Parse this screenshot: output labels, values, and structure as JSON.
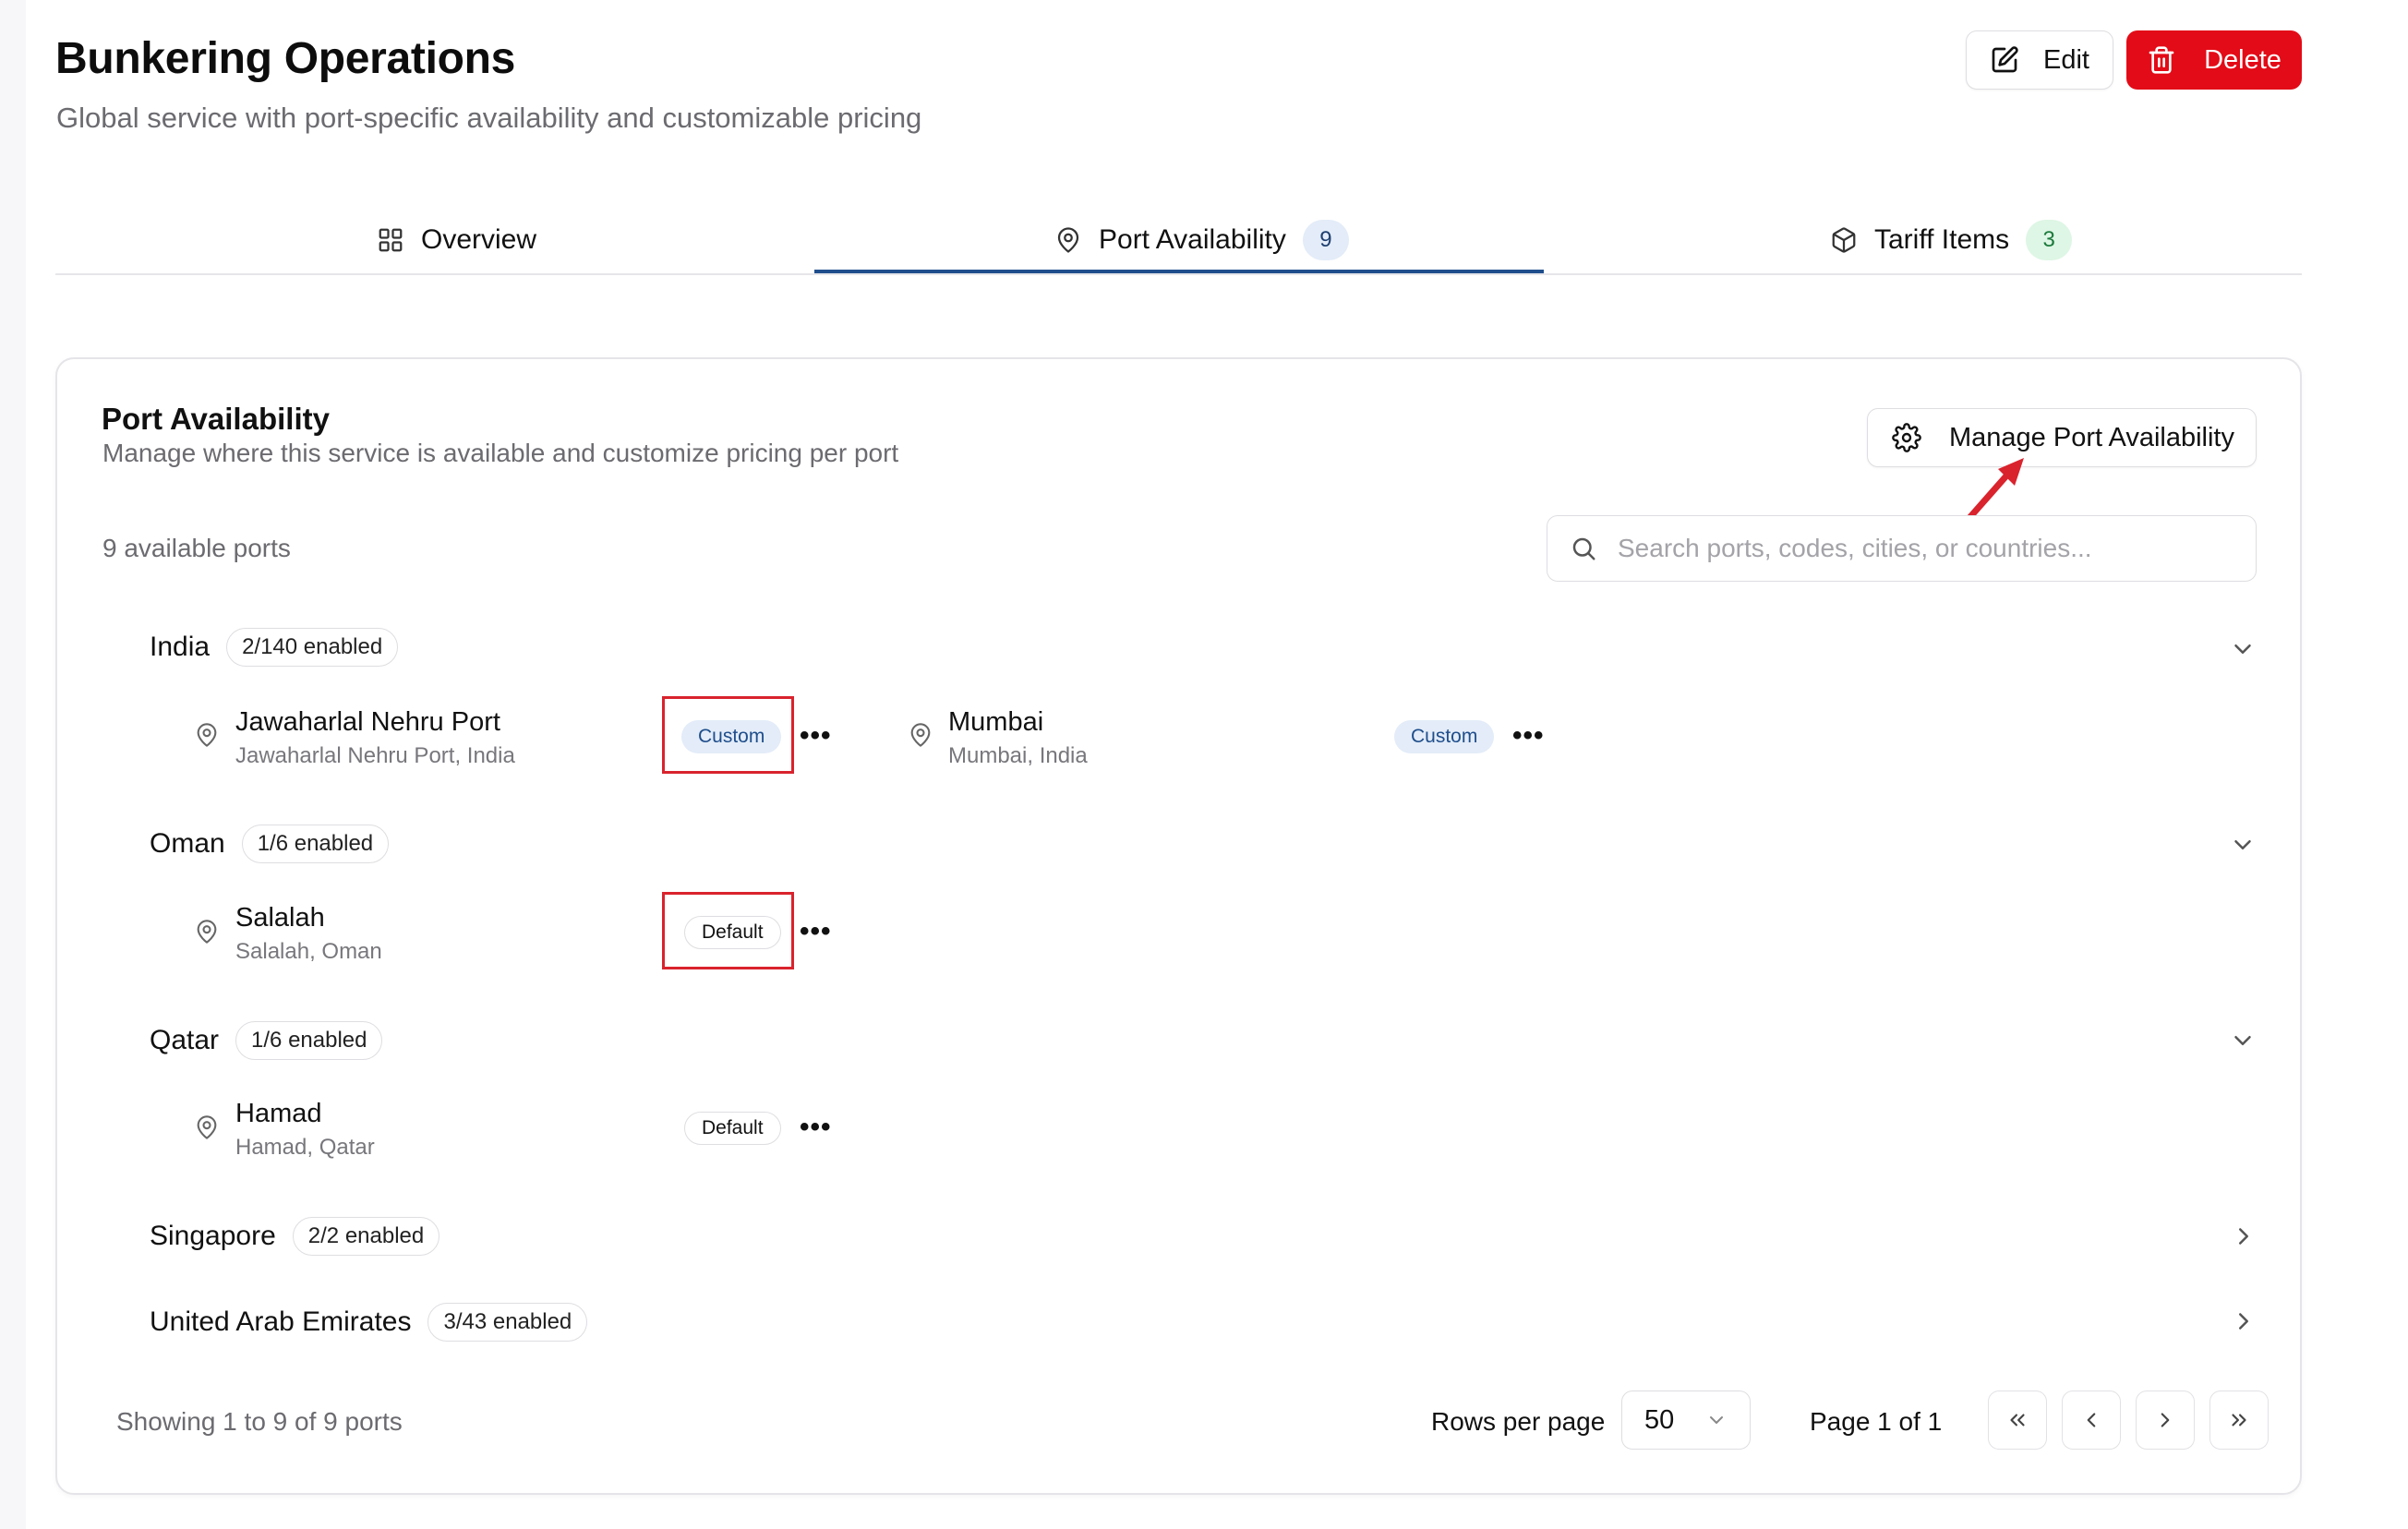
{
  "header": {
    "title": "Bunkering Operations",
    "subtitle": "Global service with port-specific availability and customizable pricing",
    "edit_label": "Edit",
    "delete_label": "Delete"
  },
  "tabs": [
    {
      "label": "Overview",
      "icon": "grid-icon"
    },
    {
      "label": "Port Availability",
      "icon": "map-pin-icon",
      "count": "9",
      "active": true
    },
    {
      "label": "Tariff Items",
      "icon": "package-icon",
      "count": "3"
    }
  ],
  "card": {
    "title": "Port Availability",
    "subtitle": "Manage where this service is available and customize pricing per port",
    "manage_label": "Manage Port Availability",
    "available_count": "9 available ports",
    "search_placeholder": "Search ports, codes, cities, or countries..."
  },
  "groups": [
    {
      "country": "India",
      "enabled": "2/140 enabled",
      "expanded": true,
      "ports": [
        {
          "name": "Jawaharlal Nehru Port",
          "location": "Jawaharlal Nehru Port, India",
          "tag": "Custom"
        },
        {
          "name": "Mumbai",
          "location": "Mumbai, India",
          "tag": "Custom"
        }
      ]
    },
    {
      "country": "Oman",
      "enabled": "1/6 enabled",
      "expanded": true,
      "ports": [
        {
          "name": "Salalah",
          "location": "Salalah, Oman",
          "tag": "Default"
        }
      ]
    },
    {
      "country": "Qatar",
      "enabled": "1/6 enabled",
      "expanded": true,
      "ports": [
        {
          "name": "Hamad",
          "location": "Hamad, Qatar",
          "tag": "Default"
        }
      ]
    },
    {
      "country": "Singapore",
      "enabled": "2/2 enabled",
      "expanded": false,
      "ports": []
    },
    {
      "country": "United Arab Emirates",
      "enabled": "3/43 enabled",
      "expanded": false,
      "ports": []
    }
  ],
  "more_glyph": "•••",
  "footer": {
    "showing": "Showing 1 to 9 of 9 ports",
    "rows_label": "Rows per page",
    "rows_value": "50",
    "page_label": "Page 1 of 1"
  },
  "colors": {
    "accent": "#1f4e8c",
    "danger": "#e30b17",
    "custom_bg": "#e3ecf8",
    "success_bg": "#def6e5",
    "highlight": "#d9232d"
  }
}
